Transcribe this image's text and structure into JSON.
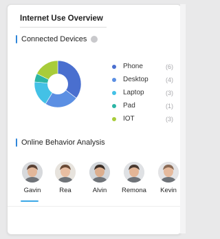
{
  "card": {
    "title": "Internet Use Overview",
    "devices_section": {
      "heading": "Connected Devices",
      "info_icon": "info-circle-icon"
    },
    "behavior_section": {
      "heading": "Online Behavior Analysis"
    }
  },
  "chart_data": {
    "type": "pie",
    "donut": true,
    "categories": [
      "Phone",
      "Desktop",
      "Laptop",
      "Pad",
      "IOT"
    ],
    "values": [
      6,
      4,
      3,
      1,
      3
    ],
    "colors": [
      "#4a6fcf",
      "#5b8fe3",
      "#43c1e6",
      "#2bb5a5",
      "#a8cc3a"
    ],
    "labels": [
      "(6)",
      "(4)",
      "(3)",
      "(1)",
      "(3)"
    ]
  },
  "people": [
    {
      "name": "Gavin",
      "avatar": "avatar-gavin",
      "selected": true
    },
    {
      "name": "Rea",
      "avatar": "avatar-rea"
    },
    {
      "name": "Alvin",
      "avatar": "avatar-alvin"
    },
    {
      "name": "Remona",
      "avatar": "avatar-remona"
    },
    {
      "name": "Kevin",
      "avatar": "avatar-kevin"
    }
  ],
  "accent_color": "#2f86d9",
  "selection_color": "#3aa7e6"
}
